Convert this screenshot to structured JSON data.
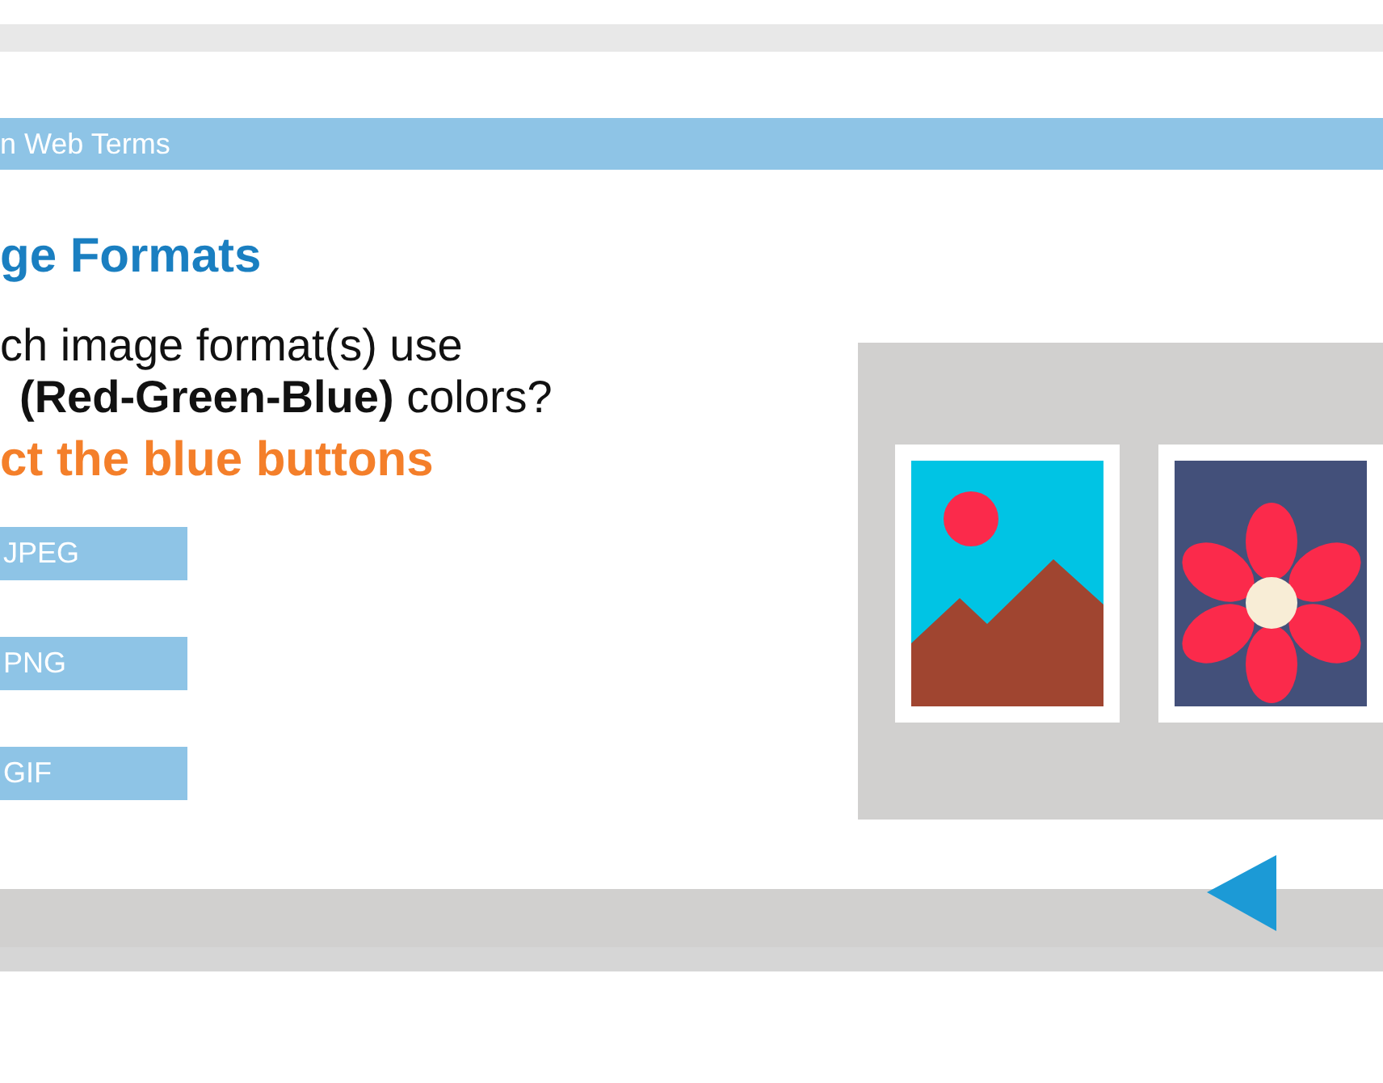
{
  "header": {
    "title": "n Web Terms"
  },
  "slide": {
    "title": "ge Formats",
    "question_lines": [
      "ch image format(s) use",
      "**(Red-Green-Blue)** colors?"
    ],
    "instruction": "ct the blue buttons",
    "options": [
      "JPEG",
      "PNG",
      "GIF"
    ]
  }
}
